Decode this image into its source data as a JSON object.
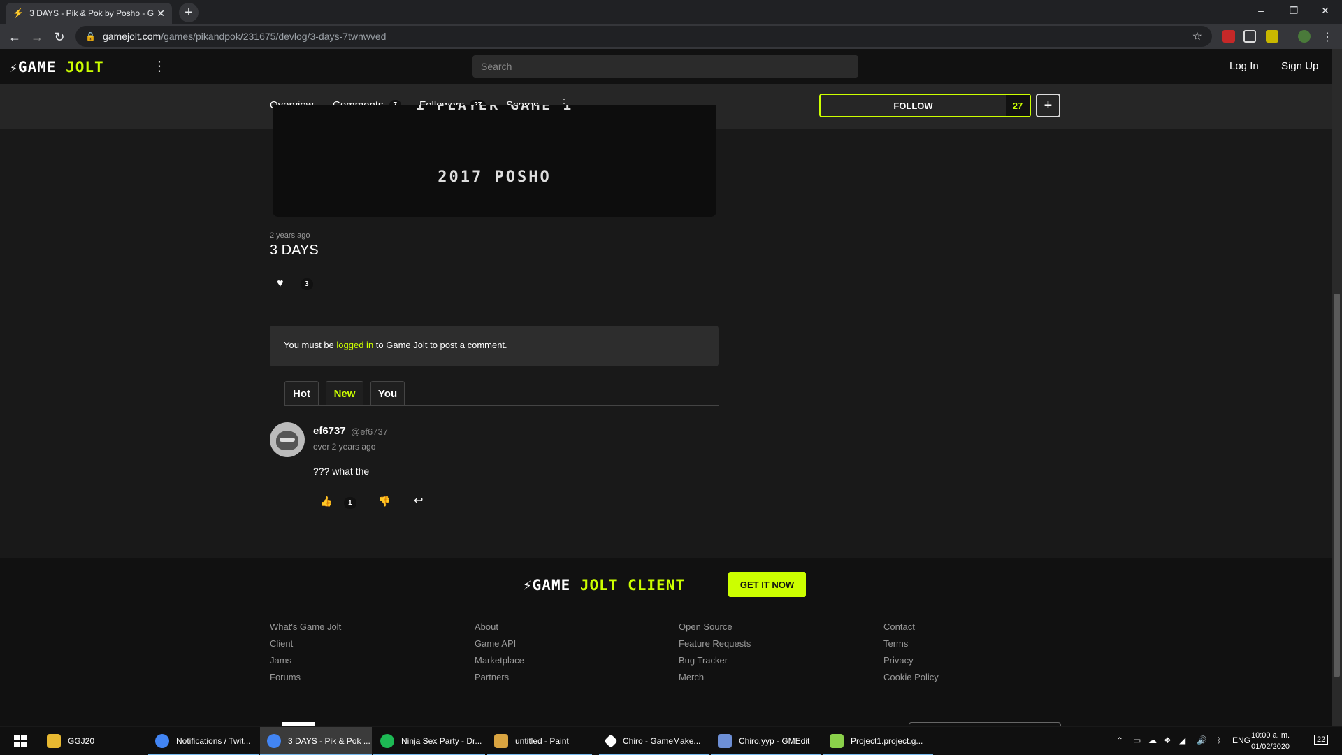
{
  "browser": {
    "tab_title": "3 DAYS - Pik & Pok by Posho - G",
    "url_host": "gamejolt.com",
    "url_path": "/games/pikandpok/231675/devlog/3-days-7twnwved",
    "new_tab_symbol": "+",
    "minimize_symbol": "–",
    "restore_symbol": "❐",
    "close_symbol": "✕"
  },
  "header": {
    "logo_game": "GAME",
    "logo_jolt": "JOLT",
    "search_placeholder": "Search",
    "login": "Log In",
    "signup": "Sign Up"
  },
  "game_nav": {
    "overview": "Overview",
    "comments": "Comments",
    "comments_count": "7",
    "followers": "Followers",
    "followers_count": "27",
    "scores": "Scores",
    "follow_label": "FOLLOW",
    "follow_count": "27",
    "plus": "+"
  },
  "banner": {
    "partial_text": "1 PLAYER GAME 1",
    "copyright": "2017 POSHO"
  },
  "post": {
    "time_ago": "2 years ago",
    "title": "3 DAYS",
    "like_count": "3"
  },
  "login_notice": {
    "prefix": "You must be ",
    "link": "logged in",
    "suffix": " to Game Jolt to post a comment."
  },
  "comment_tabs": [
    "Hot",
    "New",
    "You"
  ],
  "comment": {
    "username": "ef6737",
    "handle": "@ef6737",
    "time": "over 2 years ago",
    "body": "??? what the",
    "vote_count": "1"
  },
  "footer": {
    "client_logo_game": "GAME",
    "client_logo_jolt": "JOLT",
    "client_logo_client": "CLIENT",
    "get_it": "GET IT NOW",
    "col1": [
      "What's Game Jolt",
      "Client",
      "Jams",
      "Forums"
    ],
    "col2": [
      "About",
      "Game API",
      "Marketplace",
      "Partners"
    ],
    "col3": [
      "Open Source",
      "Feature Requests",
      "Bug Tracker",
      "Merch"
    ],
    "col4": [
      "Contact",
      "Terms",
      "Privacy",
      "Cookie Policy"
    ]
  },
  "taskbar": {
    "items": [
      {
        "label": "GGJ20",
        "color": "#e8b931"
      },
      {
        "label": "Notifications / Twit...",
        "color": "#4285f4"
      },
      {
        "label": "3 DAYS - Pik & Pok ...",
        "color": "#4285f4"
      },
      {
        "label": "Ninja Sex Party - Dr...",
        "color": "#1db954"
      },
      {
        "label": "untitled - Paint",
        "color": "#d9a441"
      },
      {
        "label": "Chiro - GameMake...",
        "color": "#ffffff"
      },
      {
        "label": "Chiro.yyp - GMEdit",
        "color": "#6d8fd6"
      },
      {
        "label": "Project1.project.g...",
        "color": "#8ad04a"
      }
    ],
    "language": "ENG",
    "time": "10:00 a. m.",
    "date": "01/02/2020",
    "notifications": "22"
  },
  "colors": {
    "accent": "#ccff00",
    "page_bg": "#191919",
    "header_bg": "#111111"
  }
}
